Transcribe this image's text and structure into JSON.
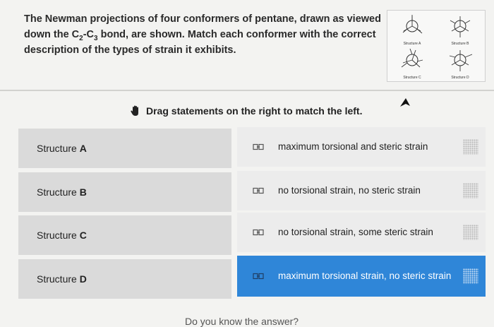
{
  "question": {
    "part1": "The Newman projections of four conformers of pentane, drawn as viewed down the C",
    "sub1": "2",
    "part2": "-C",
    "sub2": "3",
    "part3": " bond, are shown. Match each conformer with the correct description of the types of strain it exhibits."
  },
  "thumbnail": {
    "labels": [
      "Structure A",
      "Structure B",
      "Structure C",
      "Structure D"
    ]
  },
  "instruction": "Drag statements on the right to match the left.",
  "structures": [
    {
      "prefix": "Structure",
      "letter": "A"
    },
    {
      "prefix": "Structure",
      "letter": "B"
    },
    {
      "prefix": "Structure",
      "letter": "C"
    },
    {
      "prefix": "Structure",
      "letter": "D"
    }
  ],
  "statements": [
    {
      "text": "maximum torsional and steric strain"
    },
    {
      "text": "no torsional strain, no steric strain"
    },
    {
      "text": "no torsional strain, some steric strain"
    },
    {
      "text": "maximum torsional strain, no steric strain"
    }
  ],
  "footer": "Do you know the answer?",
  "colors": {
    "active_row": "#2f86d8",
    "left_row": "#dadada",
    "right_row": "#ececec"
  }
}
